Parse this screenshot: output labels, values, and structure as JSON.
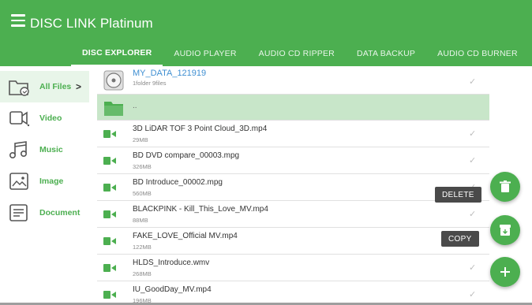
{
  "app": {
    "title": "DISC LINK Platinum"
  },
  "colors": {
    "accent": "#4caf50",
    "selected_row": "#c8e6c9",
    "disc_name": "#3f8fd2"
  },
  "tabs": [
    {
      "label": "DISC EXPLORER",
      "active": true
    },
    {
      "label": "AUDIO PLAYER",
      "active": false
    },
    {
      "label": "AUDIO CD RIPPER",
      "active": false
    },
    {
      "label": "DATA BACKUP",
      "active": false
    },
    {
      "label": "AUDIO CD BURNER",
      "active": false
    }
  ],
  "sidebar": {
    "items": [
      {
        "label": "All Files",
        "icon": "folder-icon",
        "active": true
      },
      {
        "label": "Video",
        "icon": "video-icon",
        "active": false
      },
      {
        "label": "Music",
        "icon": "music-icon",
        "active": false
      },
      {
        "label": "Image",
        "icon": "image-icon",
        "active": false
      },
      {
        "label": "Document",
        "icon": "document-icon",
        "active": false
      }
    ],
    "chevron": ">"
  },
  "files": {
    "disc": {
      "name": "MY_DATA_121919",
      "meta": "1folder 9files",
      "icon": "disc-icon"
    },
    "parent": {
      "name": "..",
      "icon": "folder-icon"
    },
    "items": [
      {
        "name": "3D LiDAR TOF 3 Point Cloud_3D.mp4",
        "size": "29MB"
      },
      {
        "name": "BD DVD compare_00003.mpg",
        "size": "326MB"
      },
      {
        "name": "BD Introduce_00002.mpg",
        "size": "560MB"
      },
      {
        "name": "BLACKPINK - Kill_This_Love_MV.mp4",
        "size": "88MB"
      },
      {
        "name": "FAKE_LOVE_Official MV.mp4",
        "size": "122MB"
      },
      {
        "name": "HLDS_Introduce.wmv",
        "size": "268MB"
      },
      {
        "name": "IU_GoodDay_MV.mp4",
        "size": "196MB"
      }
    ]
  },
  "actions": {
    "delete_label": "DELETE",
    "copy_label": "COPY"
  }
}
